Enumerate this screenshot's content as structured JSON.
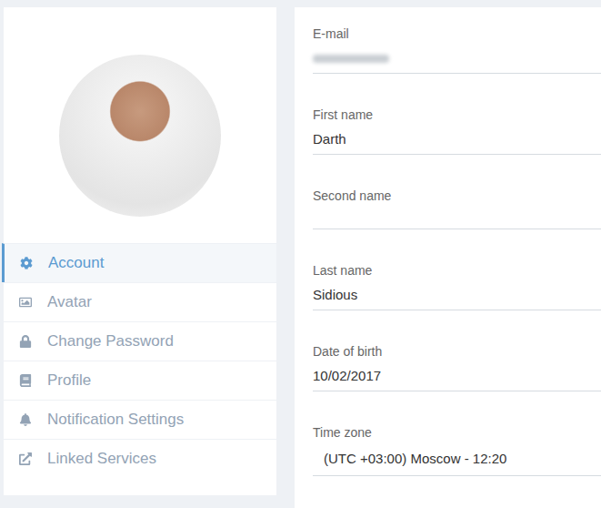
{
  "sidebar": {
    "avatar": {
      "kind": "photo"
    },
    "items": [
      {
        "label": "Account",
        "selected": true
      },
      {
        "label": "Avatar",
        "selected": false
      },
      {
        "label": "Change Password",
        "selected": false
      },
      {
        "label": "Profile",
        "selected": false
      },
      {
        "label": "Notification Settings",
        "selected": false
      },
      {
        "label": "Linked Services",
        "selected": false
      }
    ]
  },
  "form": {
    "fields": [
      {
        "label": "E-mail",
        "value": "",
        "kind": "text",
        "blurred": true
      },
      {
        "label": "First name",
        "value": "Darth",
        "kind": "text",
        "blurred": false
      },
      {
        "label": "Second name",
        "value": "",
        "kind": "text",
        "blurred": false
      },
      {
        "label": "Last name",
        "value": "Sidious",
        "kind": "text",
        "blurred": false
      },
      {
        "label": "Date of birth",
        "value": "10/02/2017",
        "kind": "text",
        "blurred": false
      },
      {
        "label": "Time zone",
        "value": "(UTC +03:00) Moscow - 12:20",
        "kind": "select",
        "blurred": false
      }
    ]
  },
  "annotation": {
    "kind": "arrow",
    "target": "Linked Services",
    "color": "#e0281f"
  }
}
